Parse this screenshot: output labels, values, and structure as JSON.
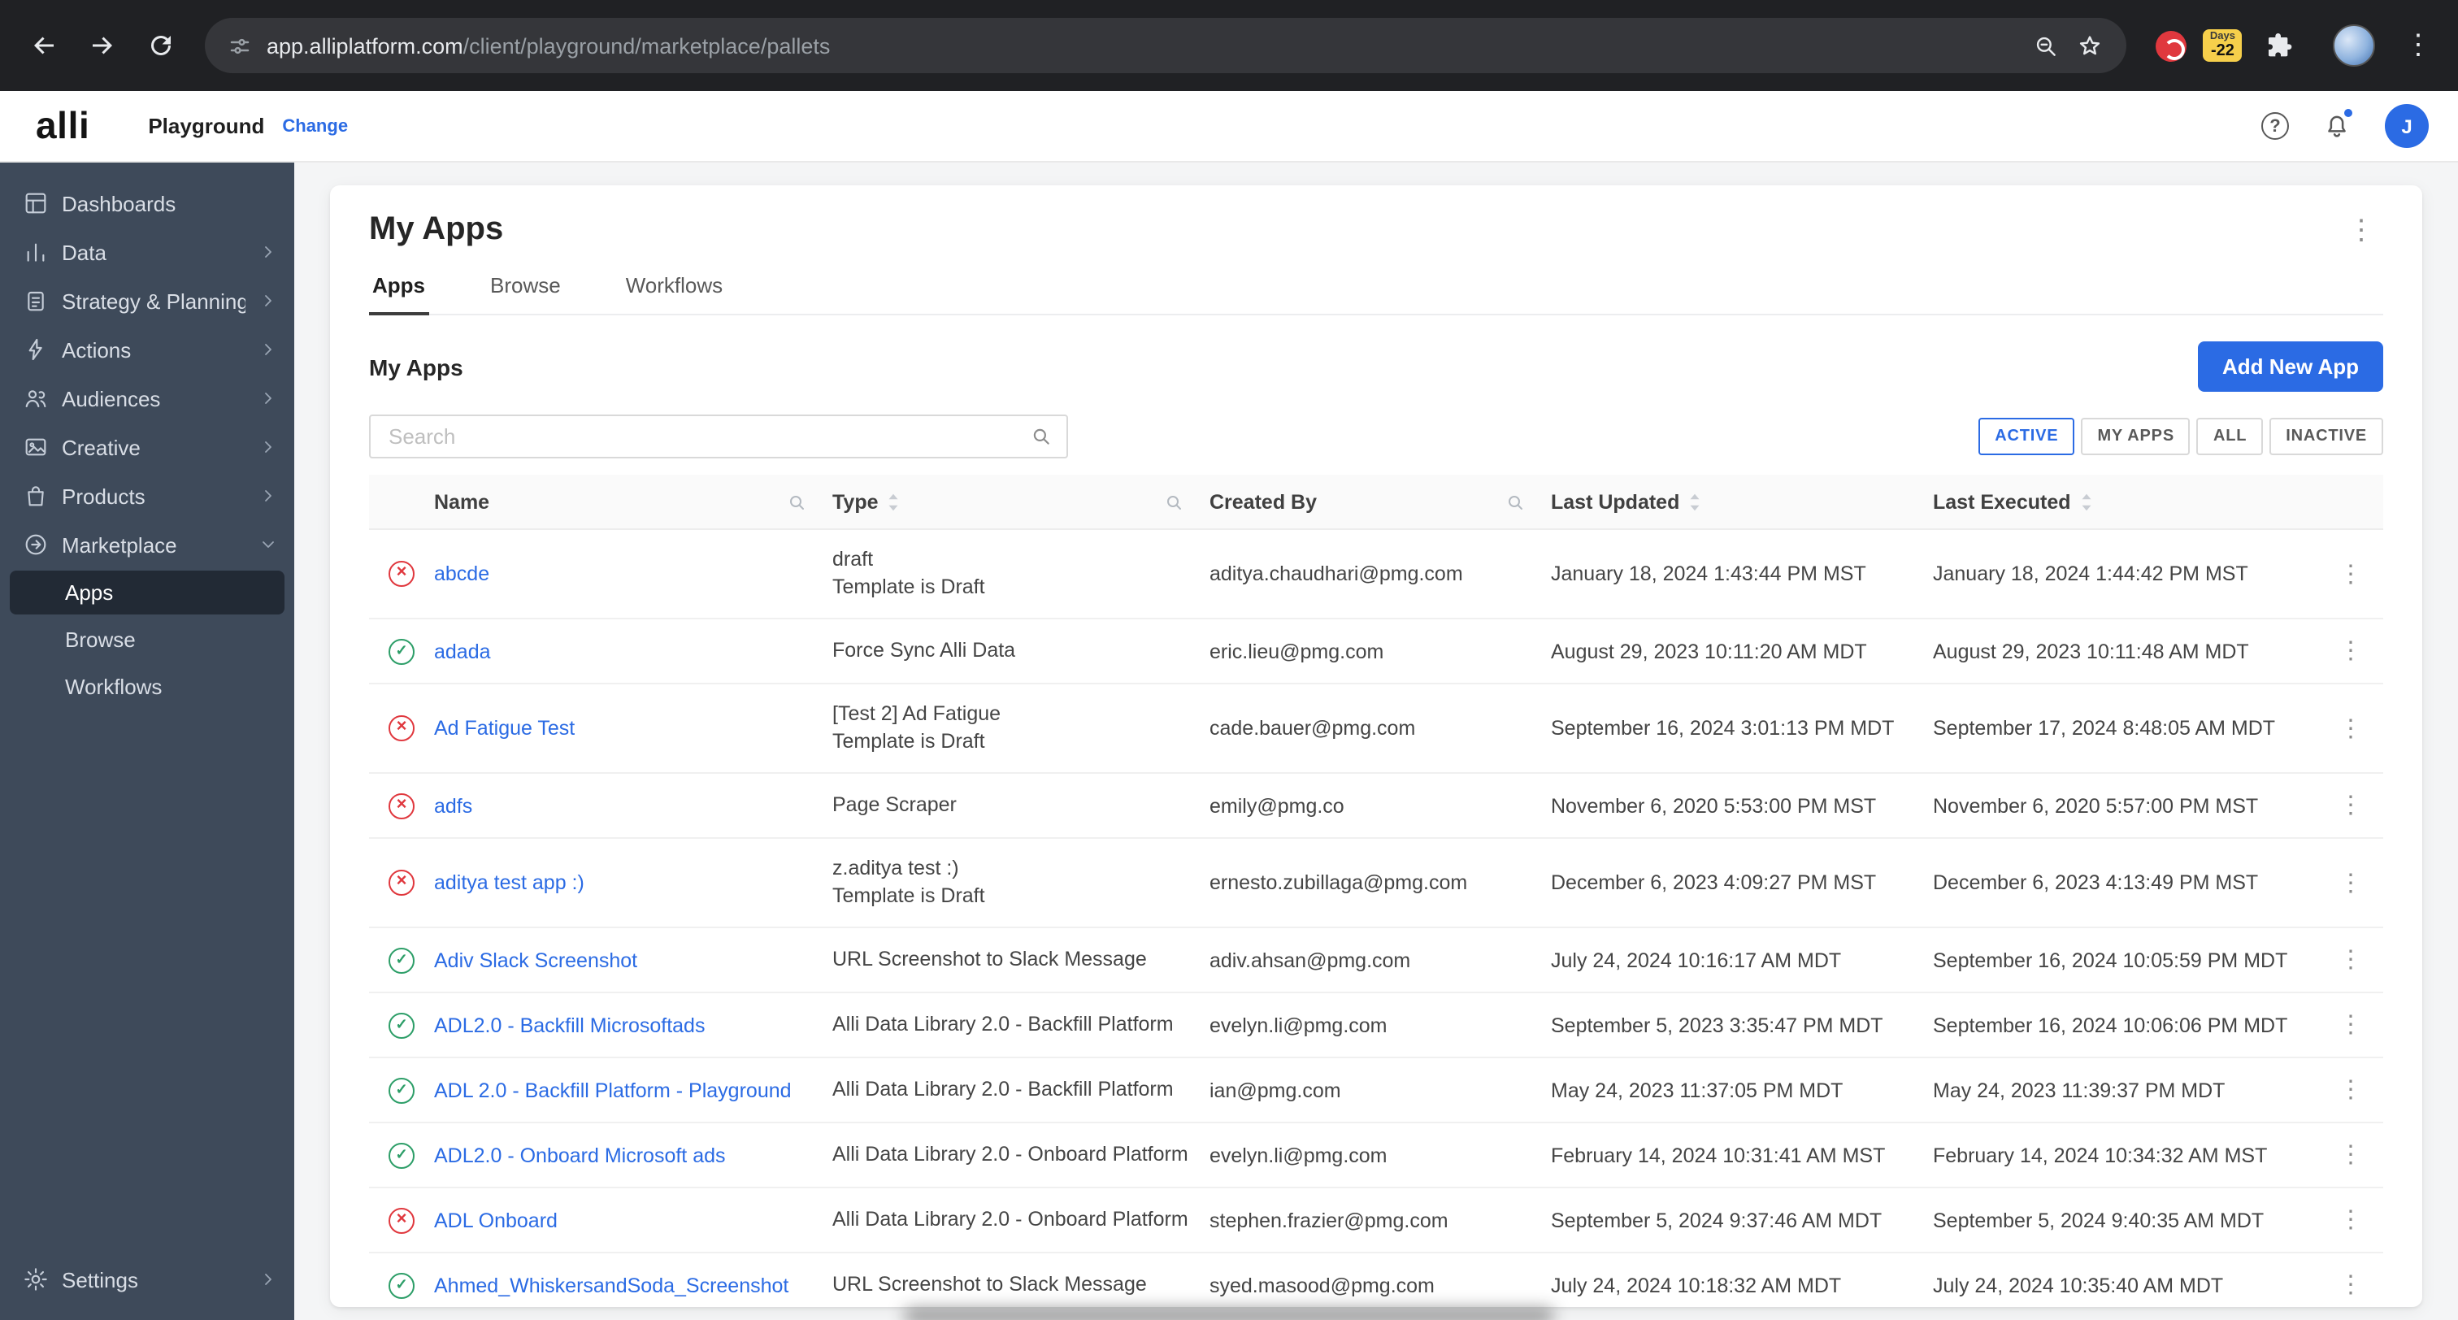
{
  "browser": {
    "url_host": "app.alliplatform.com",
    "url_path": "/client/playground/marketplace/pallets",
    "days_badge": {
      "label": "Days",
      "value": "-22"
    }
  },
  "header": {
    "logo": "alli",
    "workspace": "Playground",
    "change_link": "Change",
    "avatar_initial": "J"
  },
  "sidebar": {
    "items": [
      {
        "label": "Dashboards"
      },
      {
        "label": "Data"
      },
      {
        "label": "Strategy & Planning"
      },
      {
        "label": "Actions"
      },
      {
        "label": "Audiences"
      },
      {
        "label": "Creative"
      },
      {
        "label": "Products"
      },
      {
        "label": "Marketplace"
      }
    ],
    "marketplace_children": [
      {
        "label": "Apps",
        "cls": "active"
      },
      {
        "label": "Browse",
        "cls": ""
      },
      {
        "label": "Workflows",
        "cls": ""
      }
    ],
    "settings": {
      "label": "Settings"
    }
  },
  "main": {
    "title": "My Apps",
    "tabs": [
      {
        "label": "Apps",
        "cls": "active"
      },
      {
        "label": "Browse",
        "cls": ""
      },
      {
        "label": "Workflows",
        "cls": ""
      }
    ],
    "section_title": "My Apps",
    "add_button_label": "Add New App",
    "search_placeholder": "Search",
    "filters": [
      {
        "label": "ACTIVE",
        "cls": "active"
      },
      {
        "label": "MY APPS",
        "cls": ""
      },
      {
        "label": "ALL",
        "cls": ""
      },
      {
        "label": "INACTIVE",
        "cls": ""
      }
    ],
    "table": {
      "columns": [
        "Name",
        "Type",
        "Created By",
        "Last Updated",
        "Last Executed"
      ],
      "rows": [
        {
          "status": "err",
          "name": "abcde",
          "type": "draft",
          "type2": "Template is Draft",
          "created_by": "aditya.chaudhari@pmg.com",
          "last_updated": "January 18, 2024 1:43:44 PM MST",
          "last_executed": "January 18, 2024 1:44:42 PM MST"
        },
        {
          "status": "ok",
          "name": "adada",
          "type": "Force Sync Alli Data",
          "type2": "",
          "created_by": "eric.lieu@pmg.com",
          "last_updated": "August 29, 2023 10:11:20 AM MDT",
          "last_executed": "August 29, 2023 10:11:48 AM MDT"
        },
        {
          "status": "err",
          "name": "Ad Fatigue Test",
          "type": "[Test 2] Ad Fatigue",
          "type2": "Template is Draft",
          "created_by": "cade.bauer@pmg.com",
          "last_updated": "September 16, 2024 3:01:13 PM MDT",
          "last_executed": "September 17, 2024 8:48:05 AM MDT"
        },
        {
          "status": "err",
          "name": "adfs",
          "type": "Page Scraper",
          "type2": "",
          "created_by": "emily@pmg.co",
          "last_updated": "November 6, 2020 5:53:00 PM MST",
          "last_executed": "November 6, 2020 5:57:00 PM MST"
        },
        {
          "status": "err",
          "name": "aditya test app :)",
          "type": "z.aditya test :)",
          "type2": "Template is Draft",
          "created_by": "ernesto.zubillaga@pmg.com",
          "last_updated": "December 6, 2023 4:09:27 PM MST",
          "last_executed": "December 6, 2023 4:13:49 PM MST"
        },
        {
          "status": "ok",
          "name": "Adiv Slack Screenshot",
          "type": "URL Screenshot to Slack Message",
          "type2": "",
          "created_by": "adiv.ahsan@pmg.com",
          "last_updated": "July 24, 2024 10:16:17 AM MDT",
          "last_executed": "September 16, 2024 10:05:59 PM MDT"
        },
        {
          "status": "ok",
          "name": "ADL2.0 - Backfill Microsoftads",
          "type": "Alli Data Library 2.0 - Backfill Platform",
          "type2": "",
          "created_by": "evelyn.li@pmg.com",
          "last_updated": "September 5, 2023 3:35:47 PM MDT",
          "last_executed": "September 16, 2024 10:06:06 PM MDT"
        },
        {
          "status": "ok",
          "name": "ADL 2.0 - Backfill Platform - Playground",
          "type": "Alli Data Library 2.0 - Backfill Platform",
          "type2": "",
          "created_by": "ian@pmg.com",
          "last_updated": "May 24, 2023 11:37:05 PM MDT",
          "last_executed": "May 24, 2023 11:39:37 PM MDT"
        },
        {
          "status": "ok",
          "name": "ADL2.0 - Onboard Microsoft ads",
          "type": "Alli Data Library 2.0 - Onboard Platform",
          "type2": "",
          "created_by": "evelyn.li@pmg.com",
          "last_updated": "February 14, 2024 10:31:41 AM MST",
          "last_executed": "February 14, 2024 10:34:32 AM MST"
        },
        {
          "status": "err",
          "name": "ADL Onboard",
          "type": "Alli Data Library 2.0 - Onboard Platform",
          "type2": "",
          "created_by": "stephen.frazier@pmg.com",
          "last_updated": "September 5, 2024 9:37:46 AM MDT",
          "last_executed": "September 5, 2024 9:40:35 AM MDT"
        },
        {
          "status": "ok",
          "name": "Ahmed_WhiskersandSoda_Screenshot",
          "type": "URL Screenshot to Slack Message",
          "type2": "",
          "created_by": "syed.masood@pmg.com",
          "last_updated": "July 24, 2024 10:18:32 AM MDT",
          "last_executed": "July 24, 2024 10:35:40 AM MDT"
        }
      ]
    }
  }
}
